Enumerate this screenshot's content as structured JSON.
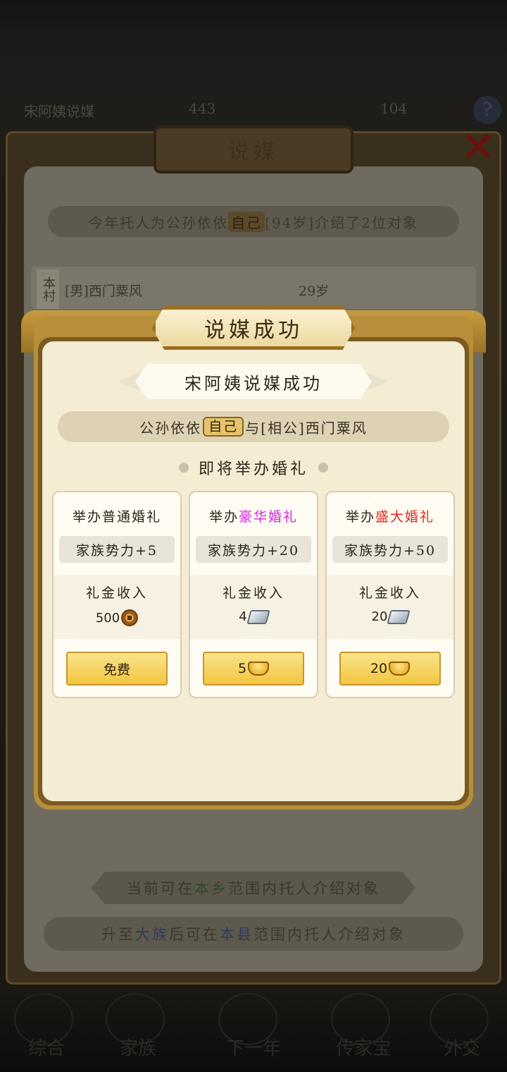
{
  "top_bar": {
    "left_text": "宋阿姨说媒",
    "center_text": "443",
    "right_text": "104"
  },
  "back_panel": {
    "title": "说媒",
    "summary_prefix": "今年托人为公孙依依",
    "summary_tag": "自己",
    "summary_suffix": "[94岁]介绍了2位对象",
    "row_tag": "本村",
    "row_name": "[男]西门粟风",
    "row_age": "29岁",
    "info1_a": "当前可在",
    "info1_b": "本乡",
    "info1_c": "范围内托人介绍对象",
    "info2_a": "升至",
    "info2_b": "大族",
    "info2_c": "后可在",
    "info2_d": "本县",
    "info2_e": "范围内托人介绍对象"
  },
  "popup": {
    "title": "说媒成功",
    "subtitle": "宋阿姨说媒成功",
    "couple_a": "公孙依依",
    "couple_tag": "自己",
    "couple_b": "与[相公]西门粟风",
    "soon_label": "即将举办婚礼",
    "cards": [
      {
        "title_prefix": "举办",
        "title_tier": "普通婚礼",
        "tier_color": "#2a2418",
        "power": "家族势力+5",
        "gift_label": "礼金收入",
        "gift_value": "500",
        "gift_icon": "copper-coin-icon",
        "button_label": "免费",
        "button_icon": ""
      },
      {
        "title_prefix": "举办",
        "title_tier": "豪华婚礼",
        "tier_color": "#d81fe0",
        "power": "家族势力+20",
        "gift_label": "礼金收入",
        "gift_value": "4",
        "gift_icon": "silver-ingot-icon",
        "button_label": "5",
        "button_icon": "gold-ingot-icon"
      },
      {
        "title_prefix": "举办",
        "title_tier": "盛大婚礼",
        "tier_color": "#e8251a",
        "power": "家族势力+50",
        "gift_label": "礼金收入",
        "gift_value": "20",
        "gift_icon": "silver-ingot-icon",
        "button_label": "20",
        "button_icon": "gold-ingot-icon"
      }
    ]
  },
  "bottom_nav": [
    "综合",
    "家族",
    "下一年",
    "传家宝",
    "外交"
  ],
  "colors": {
    "accent_gold": "#f1c540",
    "frame_gold": "#b78f3a",
    "panel_cream": "#f4ecd3",
    "purple": "#d81fe0",
    "red": "#e8251a"
  }
}
